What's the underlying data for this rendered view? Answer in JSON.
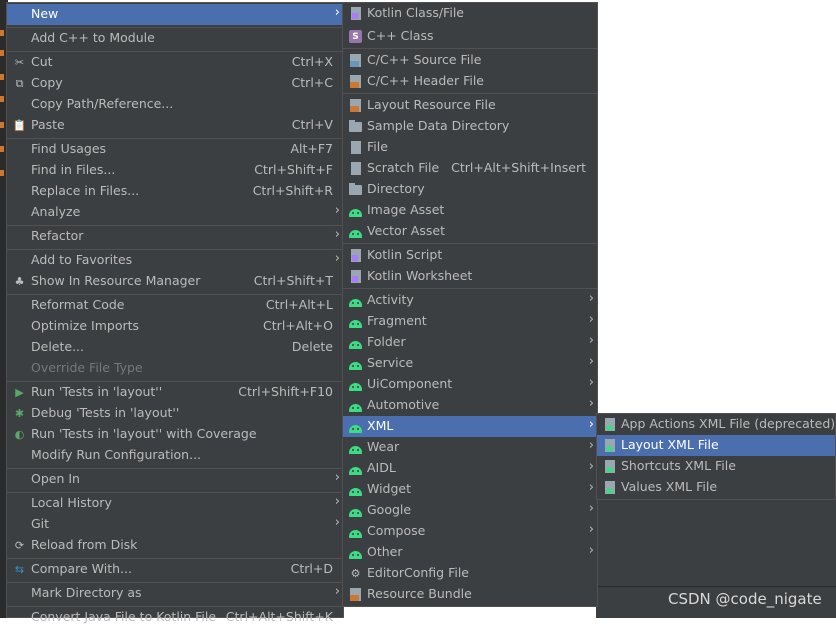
{
  "main_menu": {
    "items": [
      {
        "label": "New",
        "shortcut": "",
        "submenu": true,
        "selected": true
      },
      {
        "label": "Add C++ to Module",
        "shortcut": ""
      },
      {
        "label": "Cut",
        "shortcut": "Ctrl+X",
        "icon": "cut-icon"
      },
      {
        "label": "Copy",
        "shortcut": "Ctrl+C",
        "icon": "copy-icon"
      },
      {
        "label": "Copy Path/Reference...",
        "shortcut": ""
      },
      {
        "label": "Paste",
        "shortcut": "Ctrl+V",
        "icon": "paste-icon"
      },
      {
        "label": "Find Usages",
        "shortcut": "Alt+F7"
      },
      {
        "label": "Find in Files...",
        "shortcut": "Ctrl+Shift+F"
      },
      {
        "label": "Replace in Files...",
        "shortcut": "Ctrl+Shift+R"
      },
      {
        "label": "Analyze",
        "shortcut": "",
        "submenu": true
      },
      {
        "label": "Refactor",
        "shortcut": "",
        "submenu": true
      },
      {
        "label": "Add to Favorites",
        "shortcut": "",
        "submenu": true
      },
      {
        "label": "Show In Resource Manager",
        "shortcut": "Ctrl+Shift+T",
        "icon": "android-icon"
      },
      {
        "label": "Reformat Code",
        "shortcut": "Ctrl+Alt+L"
      },
      {
        "label": "Optimize Imports",
        "shortcut": "Ctrl+Alt+O"
      },
      {
        "label": "Delete...",
        "shortcut": "Delete"
      },
      {
        "label": "Override File Type",
        "shortcut": "",
        "disabled": true
      },
      {
        "label": "Run 'Tests in 'layout''",
        "shortcut": "Ctrl+Shift+F10",
        "icon": "run-icon"
      },
      {
        "label": "Debug 'Tests in 'layout''",
        "shortcut": "",
        "icon": "debug-icon"
      },
      {
        "label": "Run 'Tests in 'layout'' with Coverage",
        "shortcut": "",
        "icon": "coverage-icon"
      },
      {
        "label": "Modify Run Configuration...",
        "shortcut": ""
      },
      {
        "label": "Open In",
        "shortcut": "",
        "submenu": true
      },
      {
        "label": "Local History",
        "shortcut": "",
        "submenu": true
      },
      {
        "label": "Git",
        "shortcut": "",
        "submenu": true
      },
      {
        "label": "Reload from Disk",
        "shortcut": "",
        "icon": "reload-icon"
      },
      {
        "label": "Compare With...",
        "shortcut": "Ctrl+D",
        "icon": "compare-icon"
      },
      {
        "label": "Mark Directory as",
        "shortcut": "",
        "submenu": true
      },
      {
        "label": "Convert Java File to Kotlin File",
        "shortcut": "Ctrl+Alt+Shift+K"
      }
    ]
  },
  "new_menu": {
    "items": [
      {
        "label": "Kotlin Class/File",
        "shortcut": "",
        "icon": "kotlin-file-icon"
      },
      {
        "label": "C++ Class",
        "shortcut": "",
        "icon": "cpp-class-icon"
      },
      {
        "label": "C/C++ Source File",
        "shortcut": "",
        "icon": "c-source-icon"
      },
      {
        "label": "C/C++ Header File",
        "shortcut": "",
        "icon": "c-header-icon"
      },
      {
        "label": "Layout Resource File",
        "shortcut": "",
        "icon": "layout-resource-icon"
      },
      {
        "label": "Sample Data Directory",
        "shortcut": "",
        "icon": "folder-icon"
      },
      {
        "label": "File",
        "shortcut": "",
        "icon": "file-icon"
      },
      {
        "label": "Scratch File",
        "shortcut": "Ctrl+Alt+Shift+Insert",
        "icon": "scratch-file-icon"
      },
      {
        "label": "Directory",
        "shortcut": "",
        "icon": "folder-icon"
      },
      {
        "label": "Image Asset",
        "shortcut": "",
        "icon": "android-icon"
      },
      {
        "label": "Vector Asset",
        "shortcut": "",
        "icon": "android-icon"
      },
      {
        "label": "Kotlin Script",
        "shortcut": "",
        "icon": "kotlin-script-icon"
      },
      {
        "label": "Kotlin Worksheet",
        "shortcut": "",
        "icon": "kotlin-worksheet-icon"
      },
      {
        "label": "Activity",
        "submenu": true,
        "icon": "android-icon"
      },
      {
        "label": "Fragment",
        "submenu": true,
        "icon": "android-icon"
      },
      {
        "label": "Folder",
        "submenu": true,
        "icon": "android-icon"
      },
      {
        "label": "Service",
        "submenu": true,
        "icon": "android-icon"
      },
      {
        "label": "UiComponent",
        "submenu": true,
        "icon": "android-icon"
      },
      {
        "label": "Automotive",
        "submenu": true,
        "icon": "android-icon"
      },
      {
        "label": "XML",
        "submenu": true,
        "selected": true,
        "icon": "android-icon"
      },
      {
        "label": "Wear",
        "submenu": true,
        "icon": "android-icon"
      },
      {
        "label": "AIDL",
        "submenu": true,
        "icon": "android-icon"
      },
      {
        "label": "Widget",
        "submenu": true,
        "icon": "android-icon"
      },
      {
        "label": "Google",
        "submenu": true,
        "icon": "android-icon"
      },
      {
        "label": "Compose",
        "submenu": true,
        "icon": "android-icon"
      },
      {
        "label": "Other",
        "submenu": true,
        "icon": "android-icon"
      },
      {
        "label": "EditorConfig File",
        "shortcut": "",
        "icon": "gear-icon"
      },
      {
        "label": "Resource Bundle",
        "shortcut": "",
        "icon": "resource-bundle-icon"
      }
    ]
  },
  "xml_menu": {
    "items": [
      {
        "label": "App Actions XML File (deprecated)",
        "icon": "android-file-icon"
      },
      {
        "label": "Layout XML File",
        "icon": "android-file-icon",
        "selected": true
      },
      {
        "label": "Shortcuts XML File",
        "icon": "android-file-icon"
      },
      {
        "label": "Values XML File",
        "icon": "android-file-icon"
      }
    ]
  },
  "watermark": "CSDN @code_nigate",
  "colors": {
    "menu_bg": "#3c3f41",
    "selection": "#4b6eaf",
    "text": "#bbbbbb",
    "android_green": "#3ddc84"
  }
}
